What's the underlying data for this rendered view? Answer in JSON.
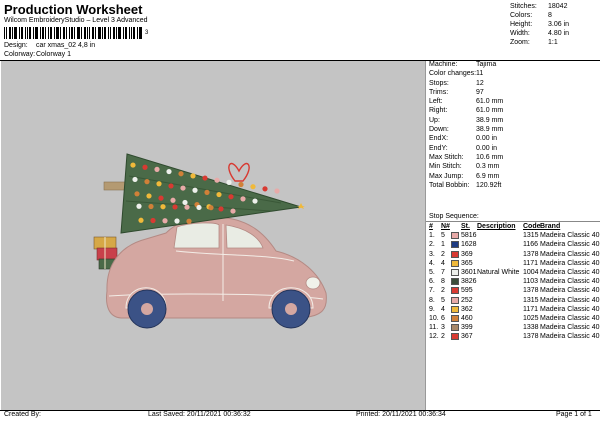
{
  "header": {
    "title": "Production Worksheet",
    "subtitle": "Wilcom EmbroideryStudio – Level 3 Advanced",
    "barcode_digit": "3",
    "design_label": "Design:",
    "design_value": "car xmas_02 4,8 in",
    "colorway_label": "Colorway:",
    "colorway_value": "Colorway 1"
  },
  "top_right": {
    "stitches_label": "Stitches:",
    "stitches_value": "18042",
    "colors_label": "Colors:",
    "colors_value": "8",
    "height_label": "Height:",
    "height_value": "3.06 in",
    "width_label": "Width:",
    "width_value": "4.80 in",
    "zoom_label": "Zoom:",
    "zoom_value": "1:1"
  },
  "stats": [
    {
      "label": "Machine:",
      "value": "Tajima"
    },
    {
      "label": "Color changes:",
      "value": "11"
    },
    {
      "label": "Stops:",
      "value": "12"
    },
    {
      "label": "Trims:",
      "value": "97"
    },
    {
      "label": "Left:",
      "value": "61.0 mm"
    },
    {
      "label": "Right:",
      "value": "61.0 mm"
    },
    {
      "label": "Up:",
      "value": "38.9 mm"
    },
    {
      "label": "Down:",
      "value": "38.9 mm"
    },
    {
      "label": "EndX:",
      "value": "0.00 in"
    },
    {
      "label": "EndY:",
      "value": "0.00 in"
    },
    {
      "label": "Max Stitch:",
      "value": "10.6 mm"
    },
    {
      "label": "Min Stitch:",
      "value": "0.3 mm"
    },
    {
      "label": "Max Jump:",
      "value": "6.9 mm"
    },
    {
      "label": "Total Bobbin:",
      "value": "120.92ft"
    }
  ],
  "stop_sequence": {
    "title": "Stop Sequence:",
    "headers": [
      "#",
      "N#",
      "St.",
      "Description",
      "Code",
      "Brand"
    ],
    "rows": [
      {
        "num": "1.",
        "n": "5",
        "color": "#e8aaa8",
        "st": "5816",
        "desc": "",
        "code": "1315",
        "brand": "Madeira Classic 40"
      },
      {
        "num": "2.",
        "n": "1",
        "color": "#1f3c82",
        "st": "1628",
        "desc": "",
        "code": "1166",
        "brand": "Madeira Classic 40"
      },
      {
        "num": "3.",
        "n": "2",
        "color": "#d83a32",
        "st": "369",
        "desc": "",
        "code": "1378",
        "brand": "Madeira Classic 40"
      },
      {
        "num": "4.",
        "n": "4",
        "color": "#f0b93a",
        "st": "365",
        "desc": "",
        "code": "1171",
        "brand": "Madeira Classic 40"
      },
      {
        "num": "5.",
        "n": "7",
        "color": "#eef0ec",
        "st": "3601",
        "desc": "Natural White",
        "code": "1004",
        "brand": "Madeira Classic 40"
      },
      {
        "num": "6.",
        "n": "8",
        "color": "#3c4e3a",
        "st": "3826",
        "desc": "",
        "code": "1103",
        "brand": "Madeira Classic 40"
      },
      {
        "num": "7.",
        "n": "2",
        "color": "#d83a32",
        "st": "595",
        "desc": "",
        "code": "1378",
        "brand": "Madeira Classic 40"
      },
      {
        "num": "8.",
        "n": "5",
        "color": "#e8aaa8",
        "st": "252",
        "desc": "",
        "code": "1315",
        "brand": "Madeira Classic 40"
      },
      {
        "num": "9.",
        "n": "4",
        "color": "#f0b93a",
        "st": "362",
        "desc": "",
        "code": "1171",
        "brand": "Madeira Classic 40"
      },
      {
        "num": "10.",
        "n": "6",
        "color": "#d08038",
        "st": "460",
        "desc": "",
        "code": "1025",
        "brand": "Madeira Classic 40"
      },
      {
        "num": "11.",
        "n": "3",
        "color": "#a88868",
        "st": "399",
        "desc": "",
        "code": "1338",
        "brand": "Madeira Classic 40"
      },
      {
        "num": "12.",
        "n": "2",
        "color": "#d83a32",
        "st": "367",
        "desc": "",
        "code": "1378",
        "brand": "Madeira Classic 40"
      }
    ]
  },
  "footer": {
    "created": "Created By:",
    "last_saved": "Last Saved: 20/11/2021 00:36:32",
    "printed": "Printed: 20/11/2021 00:36:34",
    "page": "Page 1 of 1"
  },
  "colors": {
    "background": "#c4c4c4",
    "car_body": "#d4a7a1",
    "tire": "#3b5286",
    "tree": "#4a6a48"
  }
}
